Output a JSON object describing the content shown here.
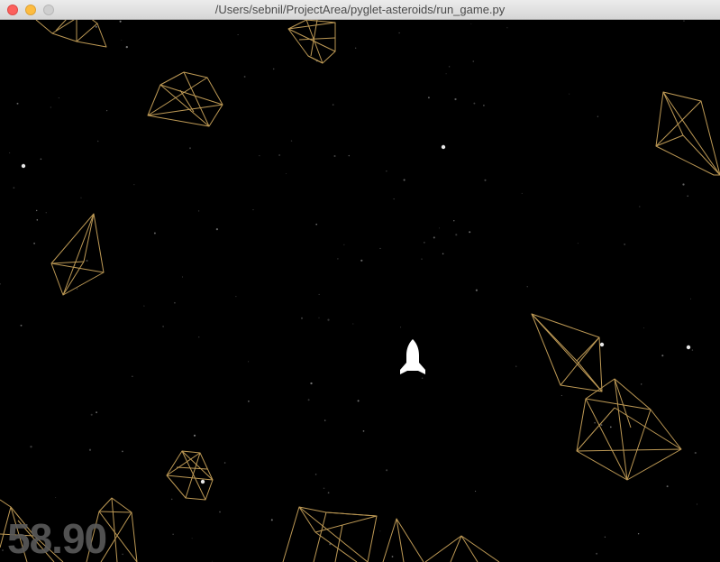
{
  "window": {
    "title": "/Users/sebnil/ProjectArea/pyglet-asteroids/run_game.py"
  },
  "hud": {
    "fps": "58.90"
  },
  "colors": {
    "background": "#000000",
    "asteroid_stroke": "#c8a25a",
    "ship": "#ffffff",
    "stars": "#9a9a9a",
    "fps_text": "#5a5a5a"
  },
  "icons": {
    "close": "close-icon",
    "minimize": "minimize-icon",
    "maximize": "maximize-icon",
    "ship": "ship-icon"
  }
}
